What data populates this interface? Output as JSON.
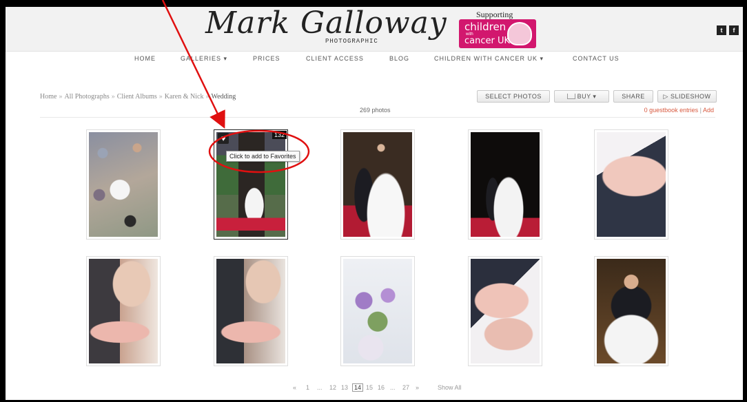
{
  "header": {
    "logo_script": "Mark Galloway",
    "logo_sub": "PHOTOGRAPHIC",
    "supporting": "Supporting",
    "charity": {
      "line1": "children",
      "with": "with",
      "line2": "cancer UK"
    },
    "social": {
      "twitter": "t",
      "facebook": "f"
    }
  },
  "nav": {
    "items": [
      {
        "label": "HOME"
      },
      {
        "label": "GALLERIES ▾"
      },
      {
        "label": "PRICES"
      },
      {
        "label": "CLIENT ACCESS"
      },
      {
        "label": "BLOG"
      },
      {
        "label": "CHILDREN WITH CANCER UK ▾"
      },
      {
        "label": "CONTACT US"
      }
    ]
  },
  "breadcrumb": {
    "items": [
      "Home",
      "All Photographs",
      "Client Albums",
      "Karen & Nick"
    ],
    "current": "Wedding",
    "separator": "»"
  },
  "toolbar": {
    "select_photos": "SELECT PHOTOS",
    "buy": "BUY ▾",
    "share": "SHARE",
    "slideshow": "▷ SLIDESHOW"
  },
  "gallery": {
    "count_label": "269 photos",
    "guestbook": "0 guestbook entries",
    "guestbook_add": "Add",
    "hover_badge": "132",
    "tooltip": "Click to add to Favorites",
    "photos": [
      {
        "subject": "confetti-crowd"
      },
      {
        "subject": "church-doorway"
      },
      {
        "subject": "couple-portrait"
      },
      {
        "subject": "couple-doorway-dark"
      },
      {
        "subject": "ring-hand-closeup"
      },
      {
        "subject": "bride-hand-shoulder"
      },
      {
        "subject": "bride-hand-shoulder-2"
      },
      {
        "subject": "bouquet-flowers"
      },
      {
        "subject": "hands-rings"
      },
      {
        "subject": "groom-bride-embrace"
      }
    ]
  },
  "pagination": {
    "prev": "«",
    "items": [
      "1",
      "...",
      "12",
      "13",
      "14",
      "15",
      "16",
      "...",
      "27"
    ],
    "current": "14",
    "next": "»",
    "show_all": "Show All"
  },
  "colors": {
    "accent": "#d8593f",
    "annotation": "#e01010",
    "charity": "#d2176e"
  }
}
